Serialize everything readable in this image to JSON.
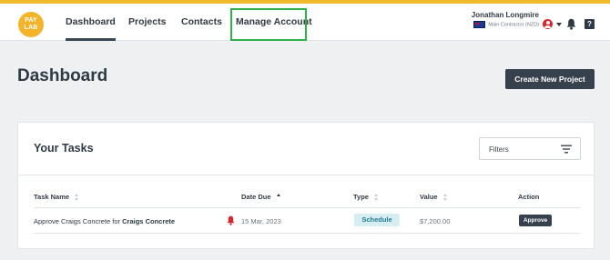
{
  "header": {
    "logo_text_top": "PAY",
    "logo_text_bottom": "LAB",
    "nav": [
      {
        "label": "Dashboard",
        "active": true
      },
      {
        "label": "Projects",
        "active": false
      },
      {
        "label": "Contacts",
        "active": false
      },
      {
        "label": "Manage Account",
        "active": false,
        "highlighted": true
      }
    ],
    "user_name": "Jonathan Longmire",
    "user_role": "Main Contractor (NZD)",
    "help_label": "?",
    "icons": [
      "nz-flag-icon",
      "user-icon",
      "chevron-down-icon",
      "bell-icon",
      "help-icon"
    ]
  },
  "page": {
    "title": "Dashboard",
    "create_button": "Create New Project"
  },
  "tasks": {
    "title": "Your Tasks",
    "filters_label": "Filters",
    "columns": [
      "Task Name",
      "Date Due",
      "Type",
      "Value",
      "Action"
    ],
    "sorted_column": "Date Due",
    "rows": [
      {
        "task_prefix": "Approve Craigs Concrete for ",
        "task_company": "Craigs Concrete",
        "date_due": "15 Mar, 2023",
        "type": "Schedule",
        "value": "$7,200.00",
        "action": "Approve",
        "alert": true
      }
    ]
  },
  "colors": {
    "accent": "#f2bb2c",
    "highlight_outline": "#2db34a",
    "alert_red": "#d7262e",
    "badge_bg": "#d6eef2",
    "badge_text": "#1f7a8c",
    "dark_button": "#37414d"
  }
}
